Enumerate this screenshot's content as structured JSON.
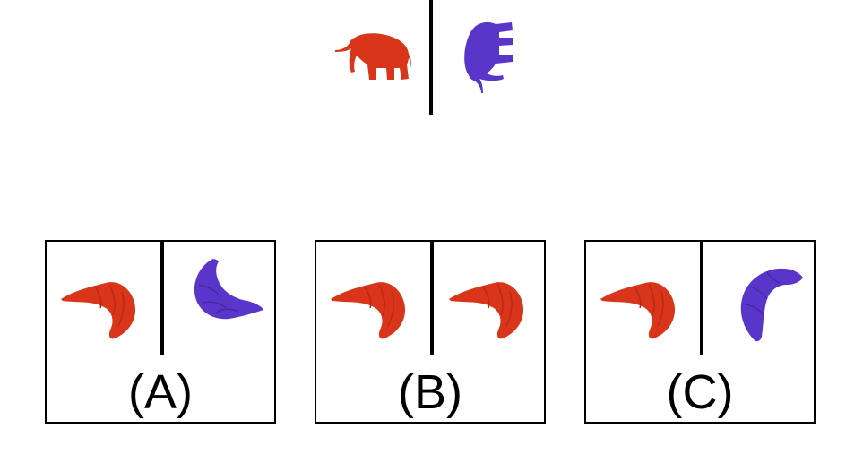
{
  "colors": {
    "red": "#d8351b",
    "blue": "#5a35c9",
    "line": "#000000",
    "background": "#ffffff"
  },
  "prompt": {
    "left_item": {
      "icon": "elephant-icon",
      "color": "red",
      "orientation": "normal"
    },
    "right_item": {
      "icon": "elephant-icon",
      "color": "blue",
      "orientation": "rotated"
    }
  },
  "options": [
    {
      "label": "(A)",
      "left_item": {
        "icon": "croissant-icon",
        "color": "red",
        "orientation": "normal"
      },
      "right_item": {
        "icon": "croissant-icon",
        "color": "blue",
        "orientation": "rotated"
      }
    },
    {
      "label": "(B)",
      "left_item": {
        "icon": "croissant-icon",
        "color": "red",
        "orientation": "normal"
      },
      "right_item": {
        "icon": "croissant-icon",
        "color": "red",
        "orientation": "normal"
      }
    },
    {
      "label": "(C)",
      "left_item": {
        "icon": "croissant-icon",
        "color": "red",
        "orientation": "normal"
      },
      "right_item": {
        "icon": "croissant-icon",
        "color": "blue",
        "orientation": "rotated"
      }
    }
  ]
}
